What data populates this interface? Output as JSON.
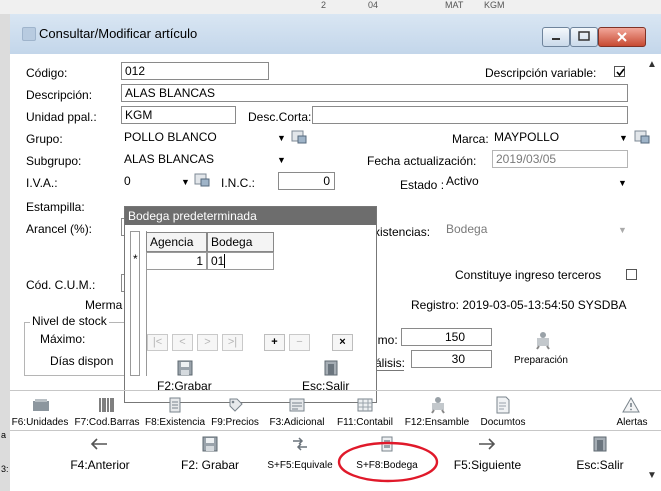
{
  "background": {
    "top_texts": [
      "2",
      "04",
      "MAT",
      "KGM"
    ],
    "left_edge_text": [
      "a",
      "3:"
    ]
  },
  "window": {
    "title": "Consultar/Modificar artículo",
    "controls": [
      "minimize",
      "maximize",
      "close"
    ]
  },
  "form": {
    "codigo_label": "Código:",
    "codigo_value": "012",
    "desc_variable_label": "Descripción variable:",
    "desc_variable_checked": true,
    "descripcion_label": "Descripción:",
    "descripcion_value": "ALAS BLANCAS",
    "unidad_label": "Unidad ppal.:",
    "unidad_value": "KGM",
    "desc_corta_label": "Desc.Corta:",
    "desc_corta_value": "",
    "grupo_label": "Grupo:",
    "grupo_value": "POLLO BLANCO",
    "marca_label": "Marca:",
    "marca_value": "MAYPOLLO",
    "subgrupo_label": "Subgrupo:",
    "subgrupo_value": "ALAS BLANCAS",
    "fecha_label": "Fecha actualización:",
    "fecha_value": "2019/03/05",
    "iva_label": "I.V.A.:",
    "iva_value": "0",
    "inc_label": "I.N.C.:",
    "inc_value": "0",
    "estado_label": "Estado :",
    "estado_value": "Activo",
    "estampilla_label": "Estampilla:",
    "arancel_label": "Arancel (%):",
    "existencias_label": "Existencias:",
    "existencias_value": "Bodega",
    "cum_label": "Cód. C.U.M.:",
    "terceros_label": "Constituye ingreso terceros",
    "terceros_checked": false,
    "merma_label": "Merma",
    "registro_text": "Registro: 2019-03-05-13:54:50 SYSDBA",
    "nivel_stock_label": "Nivel de stock",
    "maximo_label": "Máximo:",
    "minimo_label": "imo:",
    "minimo_value": "150",
    "dias_label": "Días dispon",
    "analisis_label": "álisis:",
    "analisis_value": "30",
    "preparacion_label": "Preparación"
  },
  "popup": {
    "title": "Bodega predeterminada",
    "columns": [
      "Agencia",
      "Bodega"
    ],
    "row_marker": "*",
    "row": {
      "agencia": "1",
      "bodega": "01"
    },
    "nav_buttons": [
      "|<",
      "<",
      ">",
      ">|",
      "+",
      "−",
      "×"
    ],
    "grabar_label": "F2:Grabar",
    "salir_label": "Esc:Salir"
  },
  "toolbar1": [
    {
      "label": "F6:Unidades",
      "icon": "units-icon"
    },
    {
      "label": "F7:Cod.Barras",
      "icon": "barcode-icon"
    },
    {
      "label": "F8:Existencia",
      "icon": "stock-icon"
    },
    {
      "label": "F9:Precios",
      "icon": "tag-icon"
    },
    {
      "label": "F3:Adicional",
      "icon": "form-icon"
    },
    {
      "label": "F11:Contabil",
      "icon": "ledger-icon"
    },
    {
      "label": "F12:Ensamble",
      "icon": "assembly-icon"
    },
    {
      "label": "Documtos",
      "icon": "document-icon"
    },
    {
      "label": "Alertas",
      "icon": "alert-icon"
    }
  ],
  "toolbar2": [
    {
      "label": "F4:Anterior",
      "icon": "arrow-left-icon"
    },
    {
      "label": "F2: Grabar",
      "icon": "save-icon"
    },
    {
      "label": "S+F5:Equivale",
      "icon": "equivalent-icon"
    },
    {
      "label": "S+F8:Bodega",
      "icon": "warehouse-icon"
    },
    {
      "label": "F5:Siguiente",
      "icon": "arrow-right-icon"
    },
    {
      "label": "Esc:Salir",
      "icon": "exit-icon"
    }
  ],
  "highlight_color": "#e0192a"
}
